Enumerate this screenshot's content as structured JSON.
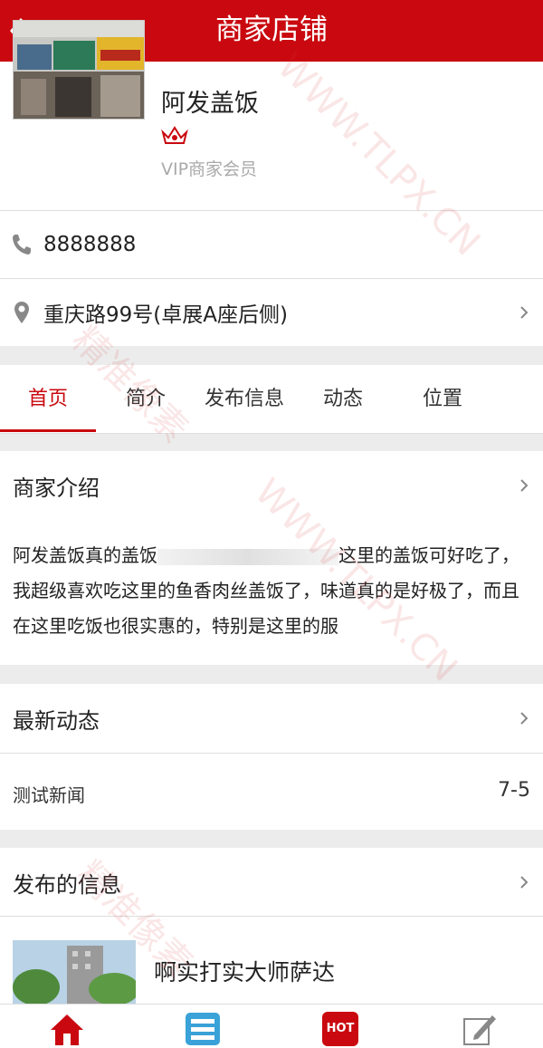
{
  "header": {
    "back_label": "返回",
    "title": "商家店铺"
  },
  "shop": {
    "name": "阿发盖饭",
    "level_label": "VIP商家会员",
    "phone": "8888888",
    "address": "重庆路99号(卓展A座后侧)"
  },
  "tabs": [
    {
      "label": "首页",
      "active": true
    },
    {
      "label": "简介"
    },
    {
      "label": "发布信息"
    },
    {
      "label": "动态"
    },
    {
      "label": "位置"
    }
  ],
  "intro": {
    "heading": "商家介绍",
    "text_start": "阿发盖饭真的盖饭",
    "text_rest": "这里的盖饭可好吃了，我超级喜欢吃这里的鱼香肉丝盖饭了，味道真的是好极了，而且在这里吃饭也很实惠的，特别是这里的服"
  },
  "news": {
    "heading": "最新动态",
    "items": [
      {
        "title": "测试新闻",
        "date": "7-5"
      }
    ]
  },
  "info": {
    "heading": "发布的信息",
    "items": [
      {
        "title": "啊实打实大师萨达"
      }
    ]
  },
  "bottom_nav": [
    {
      "icon": "home-icon"
    },
    {
      "icon": "list-icon"
    },
    {
      "icon": "hot-icon",
      "label": "HOT"
    },
    {
      "icon": "edit-icon"
    }
  ],
  "watermark": {
    "site": "WWW.TLPX.CN",
    "brand": "精准像素"
  },
  "colors": {
    "brand": "#c9090f",
    "background": "#ececec"
  }
}
